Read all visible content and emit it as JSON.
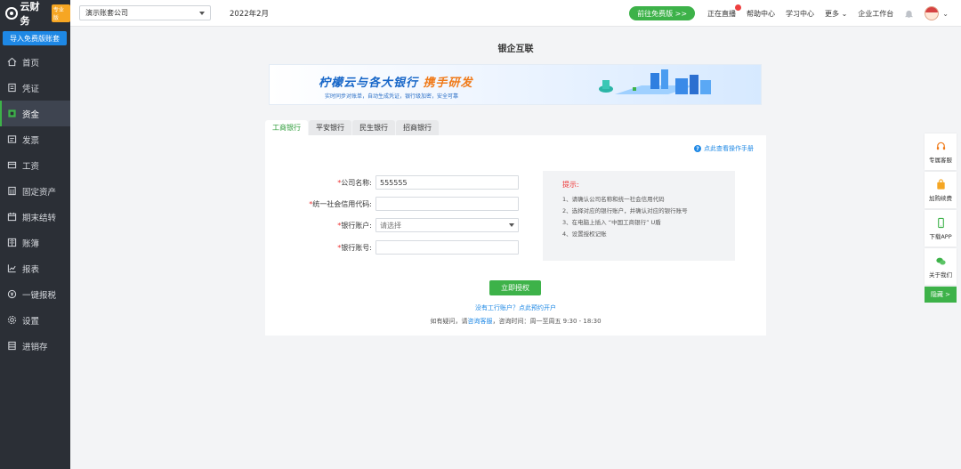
{
  "sidebar": {
    "logo_text": "云财务",
    "logo_badge": "专业版",
    "import_button": "导入免费版账套",
    "items": [
      {
        "label": "首页",
        "icon": "home-icon"
      },
      {
        "label": "凭证",
        "icon": "voucher-icon"
      },
      {
        "label": "资金",
        "icon": "funds-icon"
      },
      {
        "label": "发票",
        "icon": "invoice-icon"
      },
      {
        "label": "工资",
        "icon": "salary-icon"
      },
      {
        "label": "固定资产",
        "icon": "fixed-asset-icon"
      },
      {
        "label": "期末结转",
        "icon": "period-close-icon"
      },
      {
        "label": "账簿",
        "icon": "ledger-icon"
      },
      {
        "label": "报表",
        "icon": "report-icon"
      },
      {
        "label": "一键报税",
        "icon": "tax-icon"
      },
      {
        "label": "设置",
        "icon": "settings-icon"
      },
      {
        "label": "进销存",
        "icon": "inventory-icon"
      }
    ],
    "active_index": 2
  },
  "topbar": {
    "company": "演示账套公司",
    "period": "2022年2月",
    "go_free": "前往免费版 >>",
    "links": [
      "正在直播",
      "帮助中心",
      "学习中心",
      "更多",
      "企业工作台"
    ]
  },
  "main": {
    "title": "银企互联",
    "banner": {
      "title_main": "柠檬云与各大银行",
      "title_highlight": "携手研发",
      "subtitle": "实时同步对账单，自动生成凭证，银行级加密，安全可靠"
    },
    "tabs": [
      "工商银行",
      "平安银行",
      "民生银行",
      "招商银行"
    ],
    "active_tab": 0,
    "help_link": "点此查看操作手册",
    "form": {
      "company_label": "公司名称:",
      "company_value": "555555",
      "credit_code_label": "统一社会信用代码:",
      "credit_code_value": "",
      "bank_account_label": "银行账户:",
      "bank_account_placeholder": "请选择",
      "account_no_label": "银行账号:",
      "account_no_value": ""
    },
    "tips": {
      "title": "提示:",
      "lines": [
        "1、请确认公司名称和统一社会信用代码",
        "2、选择对应的银行账户，并确认对应的银行账号",
        "3、在电脑上插入 “中国工商银行” U盾",
        "4、设置授权记账"
      ]
    },
    "auth_button": "立即授权",
    "open_account_link": "没有工行账户？点此预约开户",
    "contact": {
      "prefix": "如有疑问，请",
      "service": "咨询客服",
      "suffix": "，咨询时间：周一至周五 9:30 - 18:30"
    }
  },
  "float_bar": {
    "items": [
      "专属客服",
      "加购续费",
      "下载APP",
      "关于我们"
    ],
    "hide": "隐藏 >"
  },
  "colors": {
    "accent": "#3db249",
    "link": "#1e88e5",
    "sidebar_bg": "#2b2f36",
    "required": "#ee3333"
  }
}
